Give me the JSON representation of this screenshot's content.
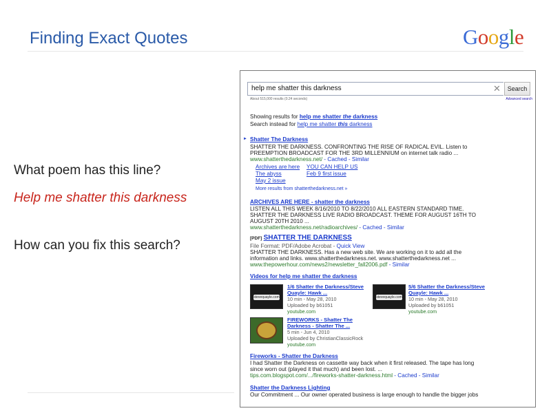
{
  "slide": {
    "title": "Finding Exact Quotes",
    "logo_letters": [
      "G",
      "o",
      "o",
      "g",
      "l",
      "e"
    ],
    "logo_colors": [
      "#3b6bd6",
      "#d23b2a",
      "#e6a817",
      "#3b6bd6",
      "#2f9a3b",
      "#d23b2a"
    ],
    "question_1": "What poem has this line?",
    "quote": "Help me shatter this darkness",
    "question_2": "How can you fix this search?"
  },
  "search": {
    "query": "help me shatter this darkness",
    "clear_symbol": "✕",
    "button_label": "Search",
    "stats": "About 515,000 results (0.24 seconds)",
    "advanced": "Advanced search",
    "showing_prefix": "Showing results for ",
    "showing_link_a": "help me shatter ",
    "showing_link_b": "the",
    "showing_link_c": " darkness",
    "instead_prefix": "Search instead for ",
    "instead_link_a": "help me shatter ",
    "instead_link_b": "this",
    "instead_link_c": " darkness"
  },
  "results": {
    "r1": {
      "title": "Shatter The Darkness",
      "line1": "SHATTER THE DARKNESS. CONFRONTING THE RISE OF RADICAL EVIL. Listen to",
      "line2": "PREEMPTION BROADCAST FOR THE 3RD MILLENNIUM on internet talk radio ...",
      "url": "www.shatterthedarkness.net/",
      "cached": " - Cached - Similar",
      "sub1_a": "Archives are here",
      "sub1_b": "YOU CAN HELP US",
      "sub2_a": "The abyss",
      "sub2_b": "Feb 9 first issue",
      "sub3_a": "May 2 issue",
      "more": "More results from shatterthedarkness.net »"
    },
    "r2": {
      "title": "ARCHIVES ARE HERE - shatter the darkness",
      "line1": "LISTEN ALL THIS WEEK 8/16/2010 TO 8/22/2010 ALL EASTERN STANDARD TIME.",
      "line2": "SHATTER THE DARKNESS LIVE RADIO BROADCAST. THEME FOR AUGUST 16TH TO",
      "line3": "AUGUST 20TH 2010 ...",
      "url": "www.shatterthedarkness.net/radioarchives/",
      "cached": " - Cached - Similar"
    },
    "r3": {
      "tag": "[PDF]",
      "title": "SHATTER THE DARKNESS",
      "format": "File Format: PDF/Adobe Acrobat - ",
      "quickview": "Quick View",
      "line1": "SHATTER THE DARKNESS. Has a new web site. We are working on it to add all the",
      "line2": "information and links. www.shatterthedarkness.net. www.shatterthedarkness.net ...",
      "url": "www.thepowerhour.com/news2/newsletter_fall2006.pdf",
      "cached": " - Similar"
    },
    "videos": {
      "heading_a": "Videos for ",
      "heading_b": "help me shatter the darkness",
      "v1_title1": "1/6 Shatter the Darkness/Steve",
      "v1_title2": "Quayle: Hawk ...",
      "v1_meta1": "10 min - May 28, 2010",
      "v1_meta2": "Uploaded by b61051",
      "v1_url": "youtube.com",
      "v1_thumb": "stevequayle.com",
      "v2_title1": "5/6 Shatter the Darkness/Steve",
      "v2_title2": "Quayle: Hawk ...",
      "v2_meta1": "10 min - May 28, 2010",
      "v2_meta2": "Uploaded by b61051",
      "v2_url": "youtube.com",
      "v2_thumb": "stevequayle.com",
      "v3_title1": "FIREWORKS - Shatter The",
      "v3_title2": "Darkness - Shatter The ...",
      "v3_meta1": "5 min - Jun 4, 2010",
      "v3_meta2": "Uploaded by ChristianClassicRock",
      "v3_url": "youtube.com"
    },
    "r4": {
      "title": "Fireworks - Shatter the Darkness",
      "line1": "I had Shatter the Darkness on cassette way back when it first released. The tape has long",
      "line2": "since worn out (played it that much) and been lost. ...",
      "url": "tips.com.blogspot.com/.../fireworks-shatter-darkness.html",
      "cached": " - Cached - Similar"
    },
    "r5": {
      "title": "Shatter the Darkness Lighting",
      "line1": "Our Commitment ... Our owner operated business is large enough to handle the bigger jobs"
    }
  }
}
